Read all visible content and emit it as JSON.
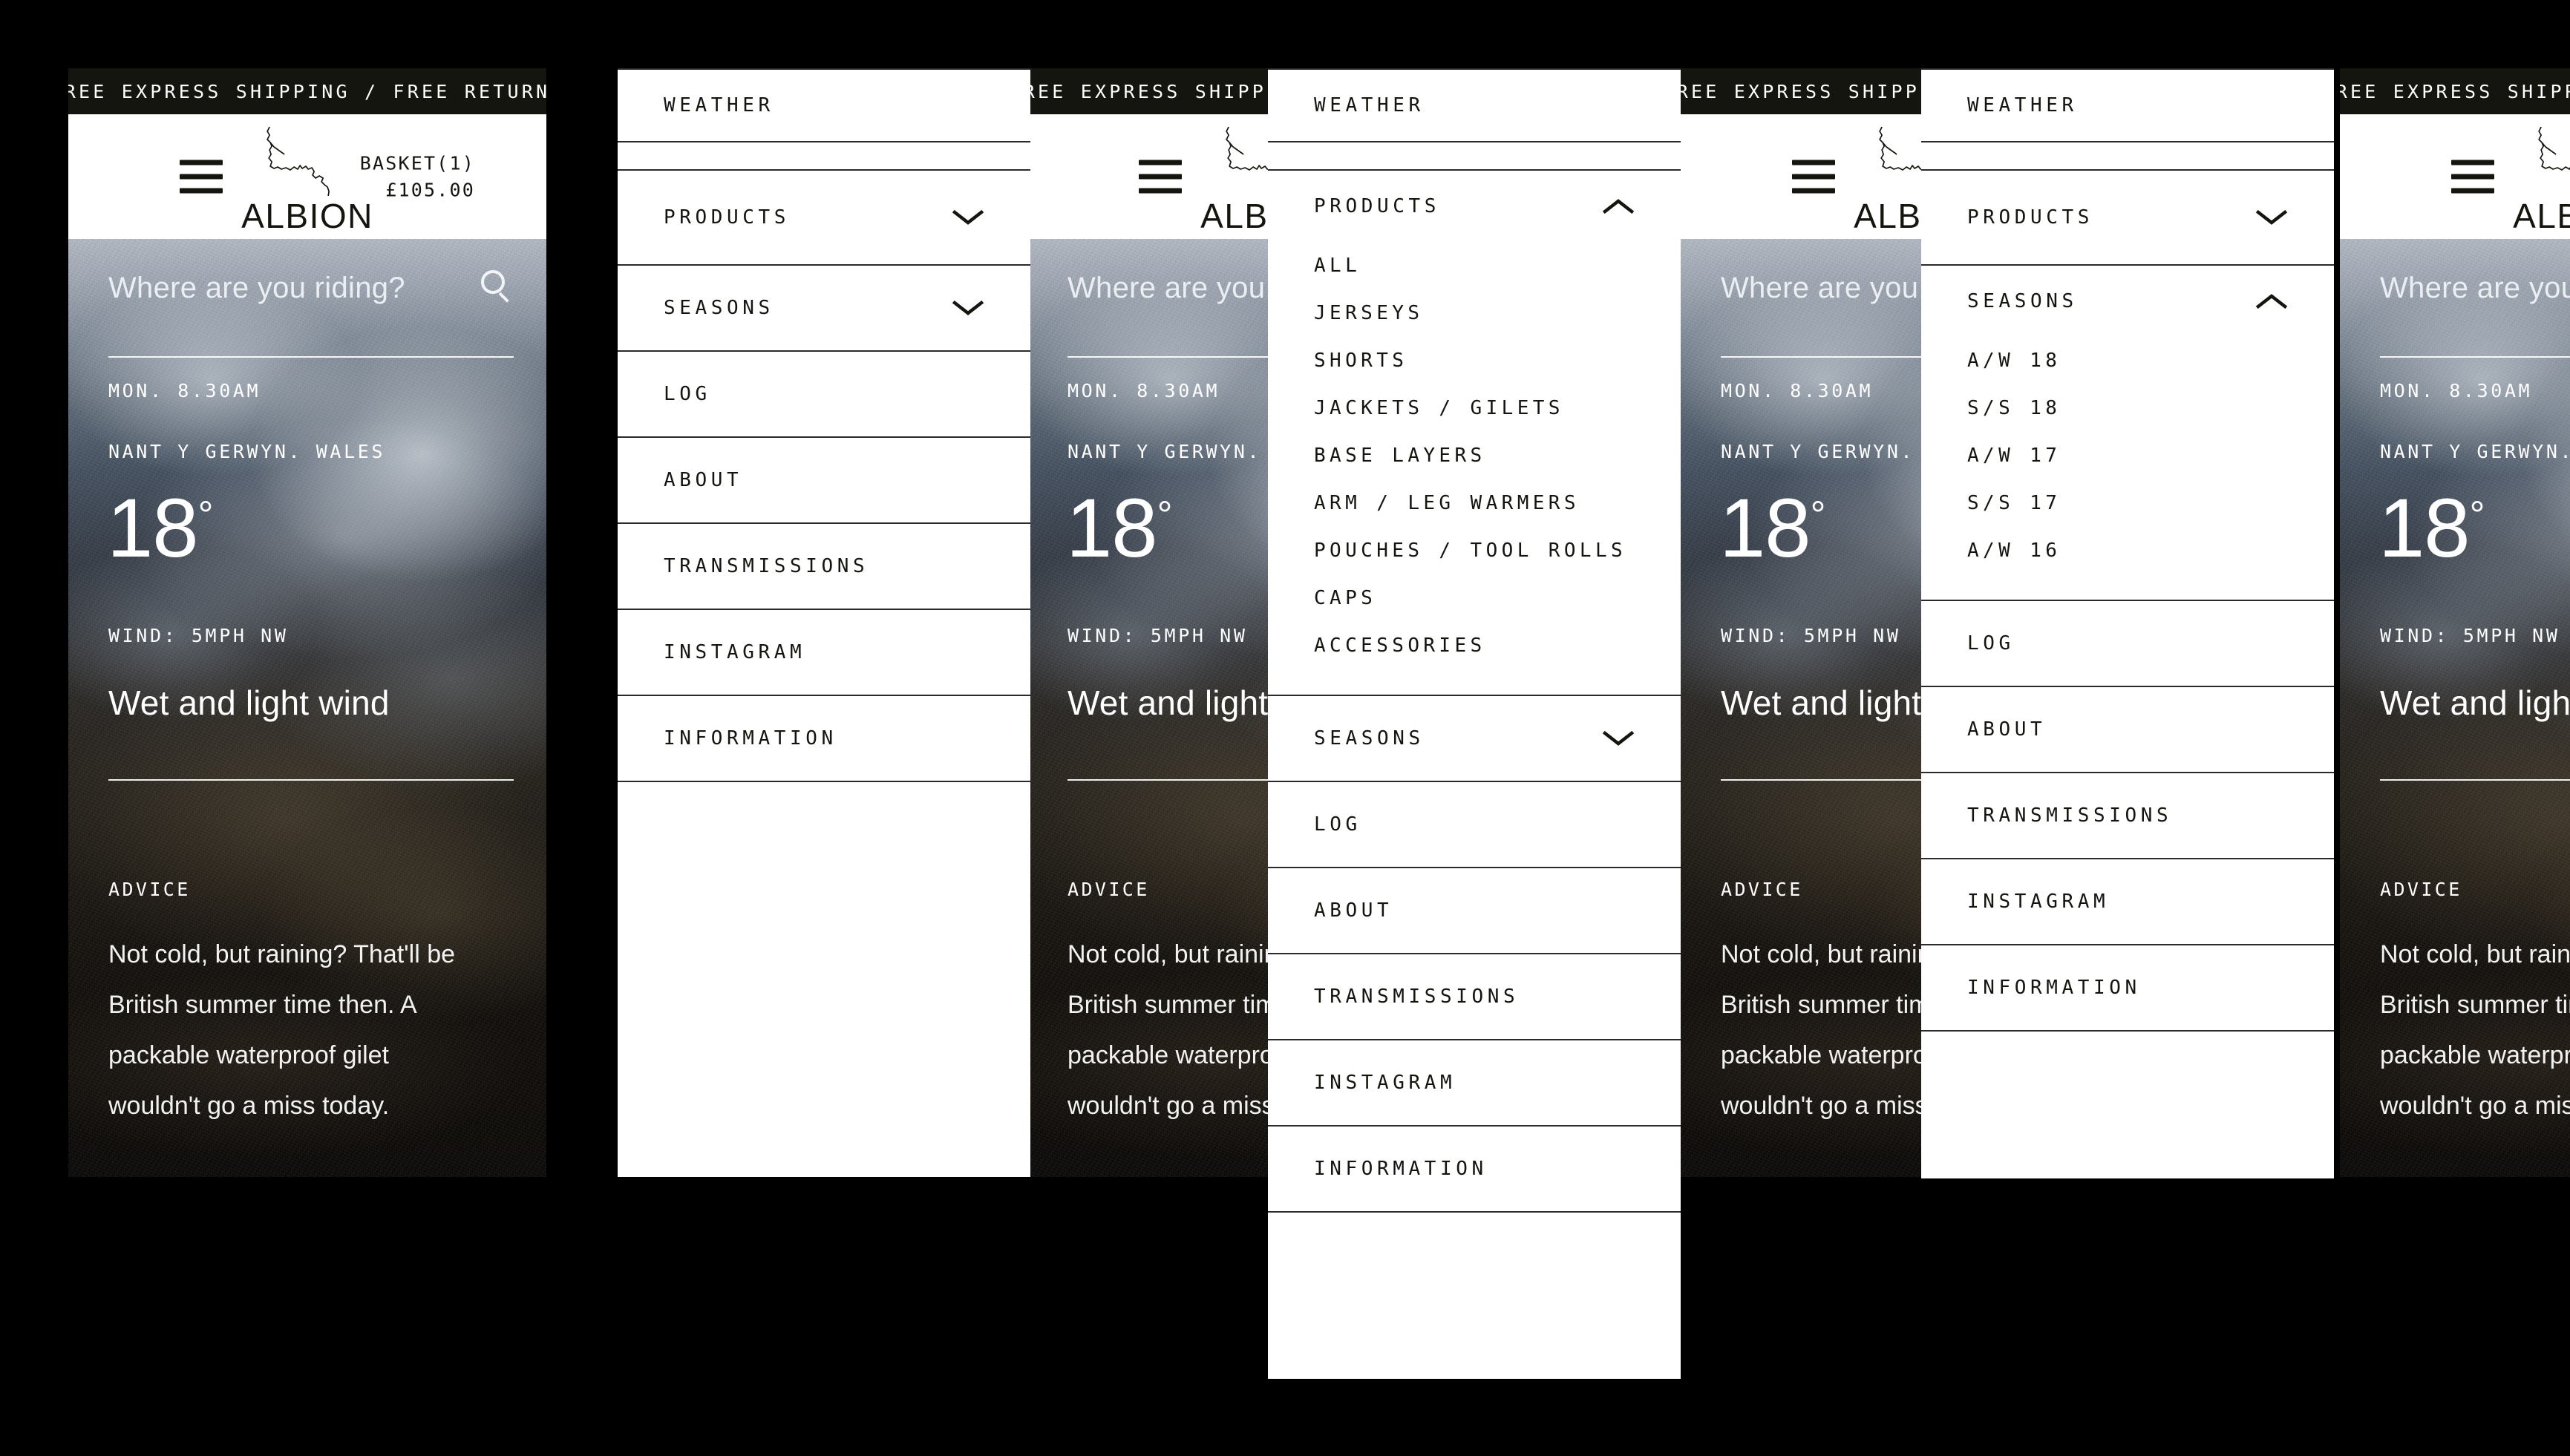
{
  "promo": {
    "text": "FREE EXPRESS SHIPPING / FREE RETURNS"
  },
  "header": {
    "brand_name": "ALBION",
    "basket_label": "BASKET(1)",
    "basket_total": "£105.00",
    "menu_icon": "hamburger-icon",
    "logo_icon": "albion-route-logo"
  },
  "search": {
    "placeholder": "Where are you riding?",
    "icon": "search-icon"
  },
  "weather": {
    "datetime": "MON. 8.30AM",
    "location": "NANT Y GERWYN. WALES",
    "temperature": "18",
    "degree_symbol": "°",
    "wind": "WIND: 5MPH NW",
    "summary": "Wet and light wind",
    "advice_label": "ADVICE",
    "advice_text": "Not cold, but raining? That'll be British summer time then. A packable waterproof gilet wouldn't go a miss today."
  },
  "menu": {
    "items": [
      {
        "label": "WEATHER",
        "expandable": false
      },
      {
        "label": "PRODUCTS",
        "expandable": true,
        "state": "collapsed"
      },
      {
        "label": "SEASONS",
        "expandable": true,
        "state": "collapsed"
      },
      {
        "label": "LOG",
        "expandable": false
      },
      {
        "label": "ABOUT",
        "expandable": false
      },
      {
        "label": "TRANSMISSIONS",
        "expandable": false
      },
      {
        "label": "INSTAGRAM",
        "expandable": false
      },
      {
        "label": "INFORMATION",
        "expandable": false
      }
    ],
    "products_sub": [
      "ALL",
      "JERSEYS",
      "SHORTS",
      "JACKETS / GILETS",
      "BASE LAYERS",
      "ARM / LEG WARMERS",
      "POUCHES / TOOL ROLLS",
      "CAPS",
      "ACCESSORIES"
    ],
    "seasons_sub": [
      "A/W 18",
      "S/S 18",
      "A/W 17",
      "S/S 17",
      "A/W 16"
    ],
    "chevron_down_icon": "chevron-down-icon",
    "chevron_up_icon": "chevron-up-icon"
  },
  "colors": {
    "background": "#000000",
    "promo_bar": "#15150f",
    "panel": "#ffffff",
    "ink": "#15150f",
    "divider": "#2a2a2a"
  },
  "panels": [
    {
      "name": "state-1-weather-closed-menu"
    },
    {
      "name": "state-2-menu-open"
    },
    {
      "name": "state-3-products-expanded"
    },
    {
      "name": "state-4-seasons-expanded"
    }
  ]
}
